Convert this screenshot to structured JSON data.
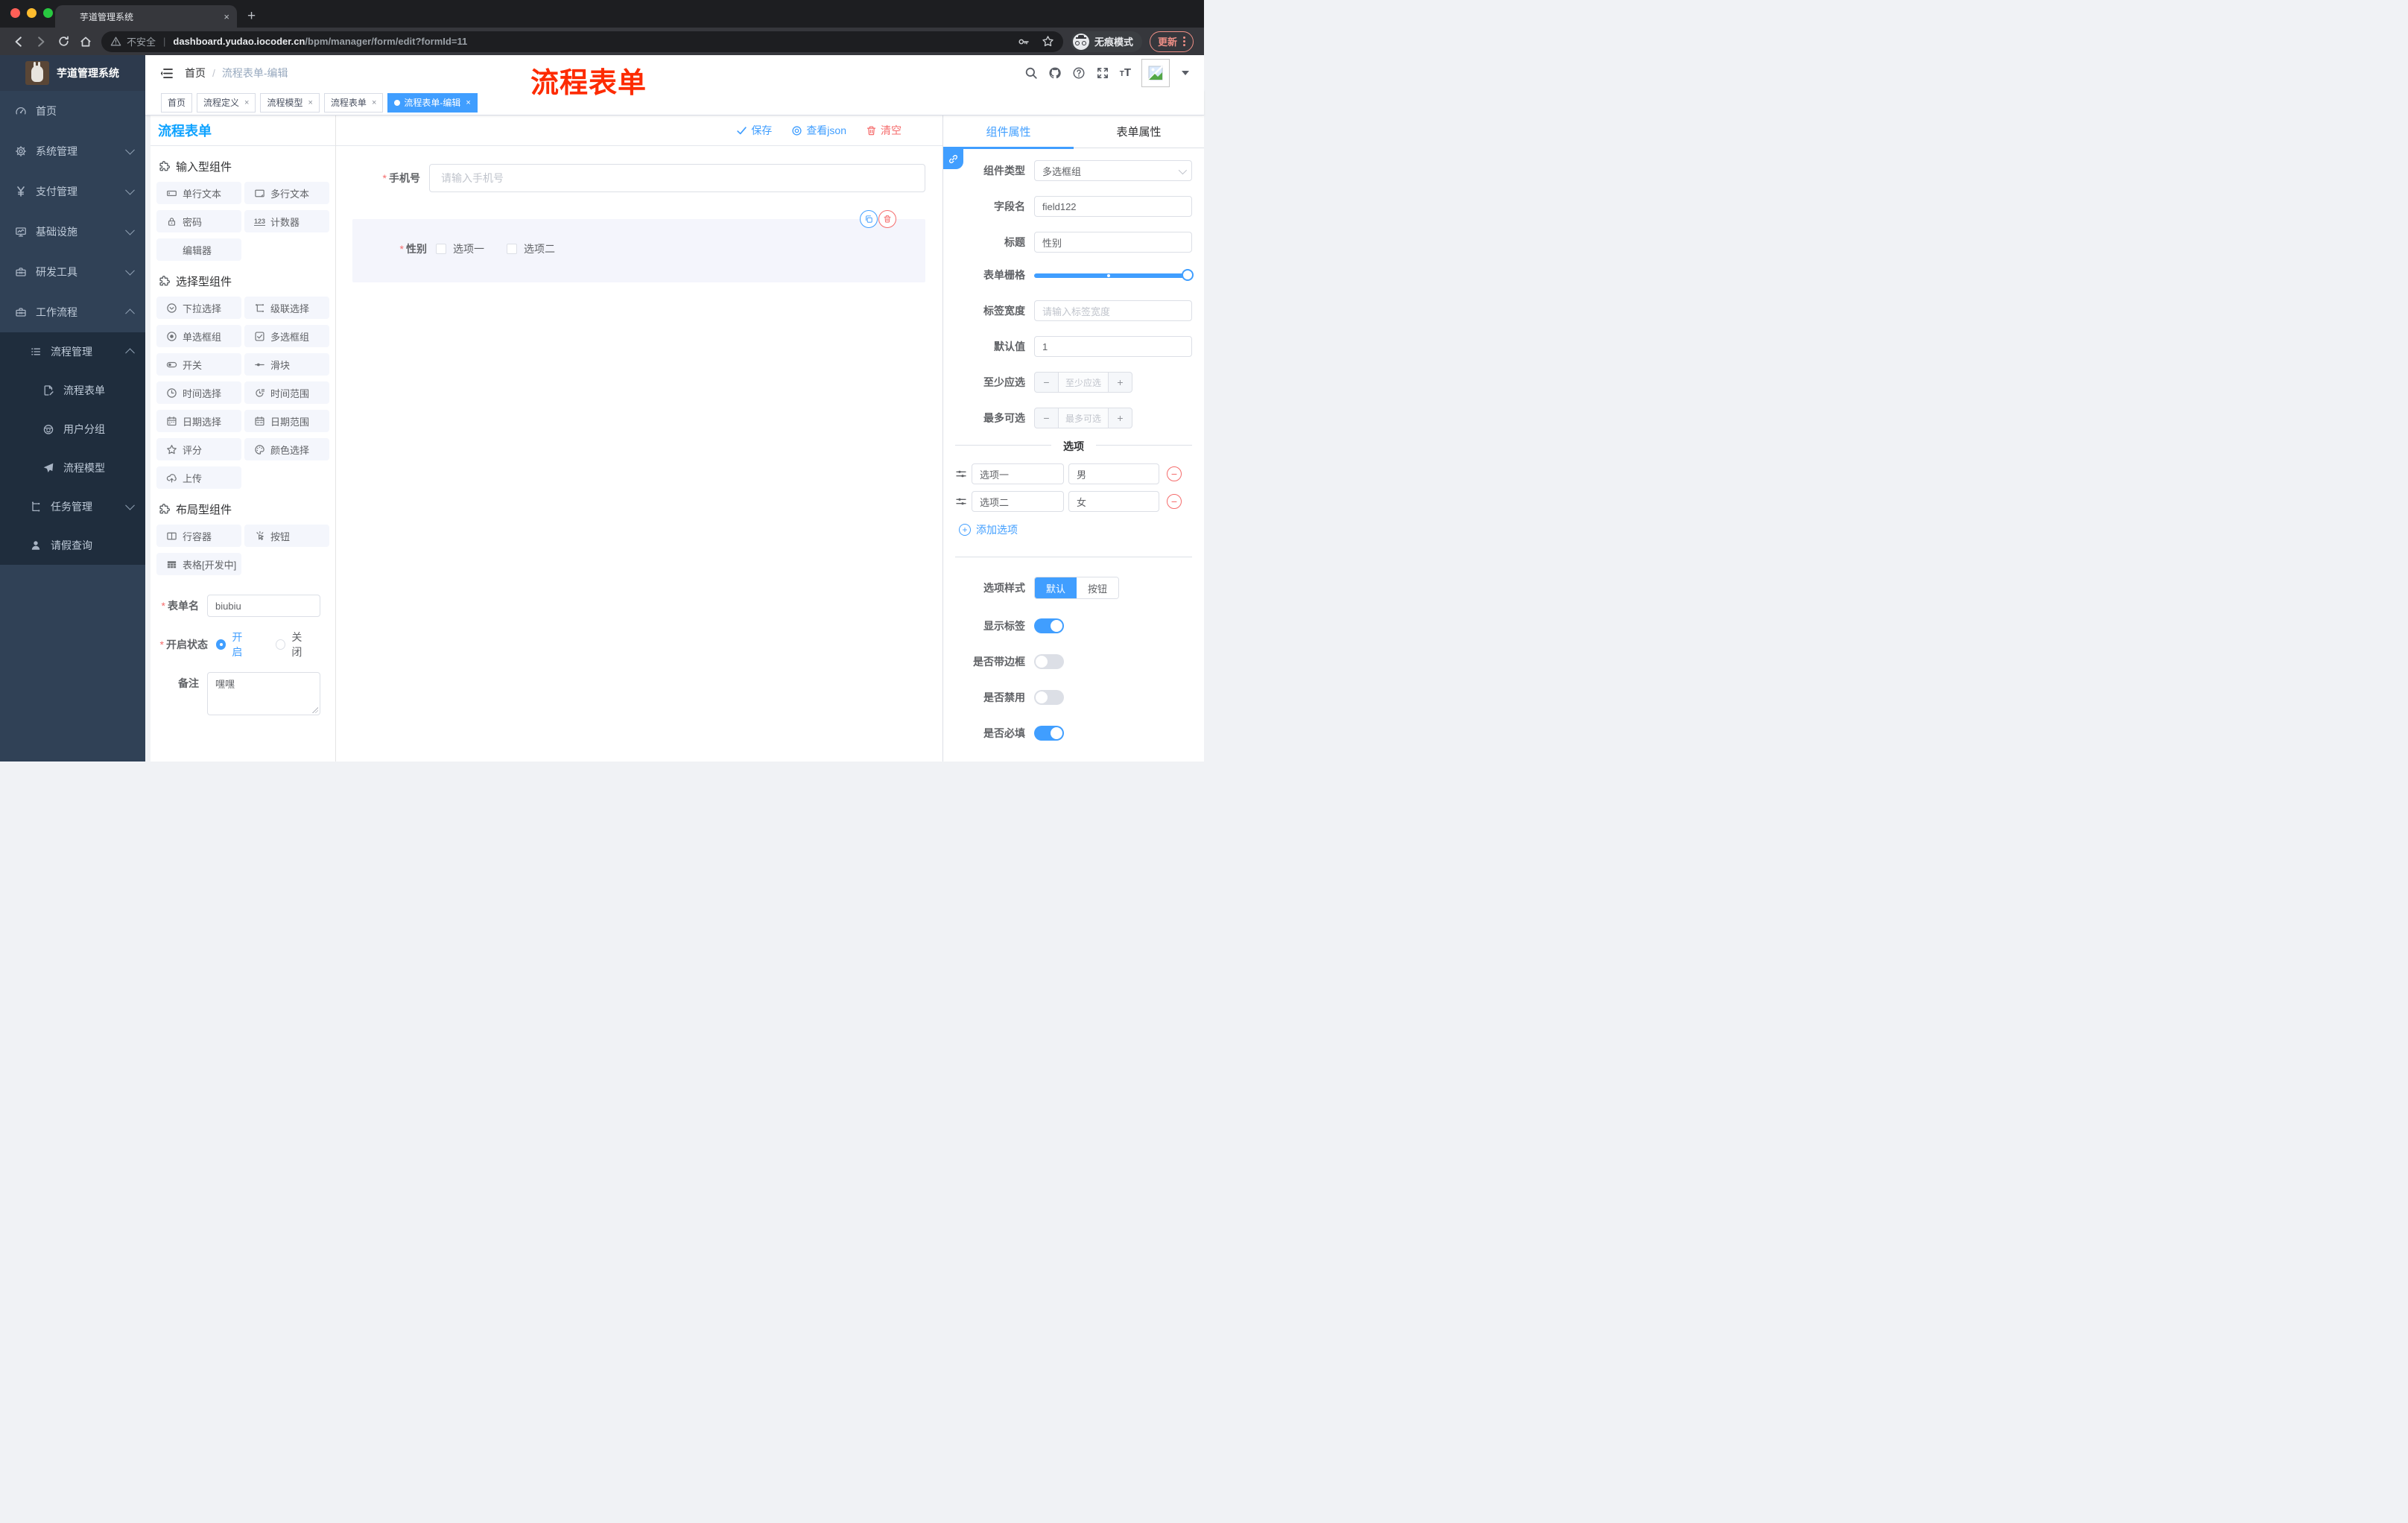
{
  "browser": {
    "tab_title": "芋道管理系统",
    "close": "×",
    "new_tab": "+",
    "security": "不安全",
    "url_host": "dashboard.yudao.iocoder.cn",
    "url_path": "/bpm/manager/form/edit?formId=11",
    "incognito": "无痕模式",
    "update": "更新"
  },
  "sidebar": {
    "logo_title": "芋道管理系统",
    "items": [
      {
        "label": "首页",
        "icon": "dashboard"
      },
      {
        "label": "系统管理",
        "icon": "gear",
        "arrow": "down"
      },
      {
        "label": "支付管理",
        "icon": "yen",
        "arrow": "down"
      },
      {
        "label": "基础设施",
        "icon": "monitor",
        "arrow": "down"
      },
      {
        "label": "研发工具",
        "icon": "toolbox",
        "arrow": "down"
      },
      {
        "label": "工作流程",
        "icon": "toolbox",
        "arrow": "up"
      },
      {
        "label": "流程管理",
        "icon": "list",
        "arrow": "up"
      },
      {
        "label": "流程表单",
        "icon": "doc-edit"
      },
      {
        "label": "用户分组",
        "icon": "robot"
      },
      {
        "label": "流程模型",
        "icon": "send"
      },
      {
        "label": "任务管理",
        "icon": "tree",
        "arrow": "down"
      },
      {
        "label": "请假查询",
        "icon": "user"
      }
    ]
  },
  "header": {
    "breadcrumb_home": "首页",
    "breadcrumb_sep": "/",
    "breadcrumb_current": "流程表单-编辑",
    "annotation": "流程表单"
  },
  "tags": [
    {
      "label": "首页",
      "closable": false,
      "active": false
    },
    {
      "label": "流程定义",
      "closable": true,
      "active": false
    },
    {
      "label": "流程模型",
      "closable": true,
      "active": false
    },
    {
      "label": "流程表单",
      "closable": true,
      "active": false
    },
    {
      "label": "流程表单-编辑",
      "closable": true,
      "active": true
    }
  ],
  "palette": {
    "title": "流程表单",
    "sections": [
      {
        "title": "输入型组件",
        "items": [
          {
            "label": "单行文本",
            "icon": "input"
          },
          {
            "label": "多行文本",
            "icon": "textarea"
          },
          {
            "label": "密码",
            "icon": "lock"
          },
          {
            "label": "计数器",
            "icon": "counter"
          },
          {
            "label": "编辑器",
            "icon": ""
          }
        ]
      },
      {
        "title": "选择型组件",
        "items": [
          {
            "label": "下拉选择",
            "icon": "select"
          },
          {
            "label": "级联选择",
            "icon": "cascader"
          },
          {
            "label": "单选框组",
            "icon": "radio"
          },
          {
            "label": "多选框组",
            "icon": "checkbox"
          },
          {
            "label": "开关",
            "icon": "switch"
          },
          {
            "label": "滑块",
            "icon": "slider"
          },
          {
            "label": "时间选择",
            "icon": "clock"
          },
          {
            "label": "时间范围",
            "icon": "time-range"
          },
          {
            "label": "日期选择",
            "icon": "calendar"
          },
          {
            "label": "日期范围",
            "icon": "calendar-range"
          },
          {
            "label": "评分",
            "icon": "star"
          },
          {
            "label": "颜色选择",
            "icon": "palette"
          },
          {
            "label": "上传",
            "icon": "upload"
          }
        ]
      },
      {
        "title": "布局型组件",
        "items": [
          {
            "label": "行容器",
            "icon": "row"
          },
          {
            "label": "按钮",
            "icon": "hand"
          },
          {
            "label": "表格[开发中]",
            "icon": "table"
          }
        ]
      }
    ],
    "form": {
      "name_label": "表单名",
      "name_value": "biubiu",
      "status_label": "开启状态",
      "status_on": "开启",
      "status_off": "关闭",
      "remark_label": "备注",
      "remark_value": "嘿嘿"
    }
  },
  "canvas": {
    "toolbar": {
      "save": "保存",
      "view_json": "查看json",
      "clear": "清空"
    },
    "phone": {
      "label": "手机号",
      "placeholder": "请输入手机号"
    },
    "gender": {
      "label": "性别",
      "option1": "选项一",
      "option2": "选项二"
    }
  },
  "panel": {
    "tab_component": "组件属性",
    "tab_form": "表单属性",
    "type_label": "组件类型",
    "type_value": "多选框组",
    "field_label": "字段名",
    "field_value": "field122",
    "title_label": "标题",
    "title_value": "性别",
    "grid_label": "表单栅格",
    "labelwidth_label": "标签宽度",
    "labelwidth_placeholder": "请输入标签宽度",
    "default_label": "默认值",
    "default_value": "1",
    "min_label": "至少应选",
    "min_placeholder": "至少应选",
    "max_label": "最多可选",
    "max_placeholder": "最多可选",
    "options_divider": "选项",
    "options": [
      {
        "label": "选项一",
        "value": "男"
      },
      {
        "label": "选项二",
        "value": "女"
      }
    ],
    "add_option": "添加选项",
    "style_label": "选项样式",
    "style_default": "默认",
    "style_button": "按钮",
    "switch_show_label": "显示标签",
    "switch_border": "是否带边框",
    "switch_disabled": "是否禁用",
    "switch_required": "是否必填"
  },
  "colors": {
    "primary": "#409eff",
    "danger": "#f56c6c",
    "annotation_red": "#fd2b01",
    "palette_title_blue": "#0da2ff",
    "sidebar_bg": "#304156",
    "submenu_bg": "#1f2d3d"
  }
}
